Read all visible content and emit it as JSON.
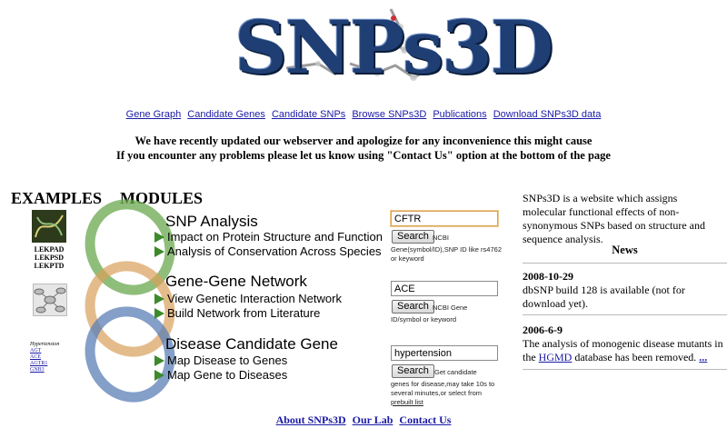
{
  "logo": {
    "text": "SNPs3D"
  },
  "nav": [
    "Gene Graph",
    "Candidate Genes",
    "Candidate SNPs",
    "Browse SNPs3D",
    "Publications",
    "Download SNPs3D data"
  ],
  "notice": {
    "line1": "We have recently updated our webserver and apologize for any inconvenience this might cause",
    "line2": "If you encounter any problems please let us know using \"Contact Us\" option at the bottom of the page"
  },
  "examples_heading": "EXAMPLES",
  "modules_heading": "MODULES",
  "examples": {
    "lek": [
      "LEKPAD",
      "LEKPSD",
      "LEKPTD"
    ],
    "hypertension": {
      "title": "Hypertension",
      "genes": [
        "AGT",
        "ACE",
        "AGTR1",
        "GNB3"
      ]
    }
  },
  "modules": [
    {
      "title": "SNP Analysis",
      "items": [
        "Impact on Protein Structure and Function",
        "Analysis of Conservation Across Species"
      ],
      "search": {
        "value": "CFTR",
        "button": "Search",
        "suffix": "NCBI",
        "hint": "Gene(symbol/ID),SNP ID like rs4762 or keyword"
      },
      "color": "#6aa84f"
    },
    {
      "title": "Gene-Gene Network",
      "items": [
        "View Genetic Interaction Network",
        "Build Network from Literature"
      ],
      "search": {
        "value": "ACE",
        "button": "Search",
        "suffix": "NCBI Gene",
        "hint": "ID/symbol or keyword"
      },
      "color": "#d9a05b"
    },
    {
      "title": "Disease Candidate Gene",
      "items": [
        "Map Disease to Genes",
        "Map Gene to Diseases"
      ],
      "search": {
        "value": "hypertension",
        "button": "Search",
        "suffix": "Get candidate",
        "hint": "genes for disease,may take 10s to several minutes,or select from",
        "link": "prebuilt list"
      },
      "color": "#5b7fb5"
    }
  ],
  "sidebar": {
    "intro": "SNPs3D is a website which assigns molecular functional effects of non-synonymous SNPs based on structure and sequence analysis.",
    "news_heading": "News",
    "news": [
      {
        "date": "2008-10-29",
        "text": "dbSNP build 128 is available (not for download yet)."
      },
      {
        "date": "2006-6-9",
        "text_before": "The analysis of monogenic disease mutants in the",
        "link": "HGMD",
        "text_after": "database has been removed.",
        "more": "..."
      }
    ]
  },
  "footer": [
    "About SNPs3D",
    "Our Lab",
    "Contact Us"
  ]
}
